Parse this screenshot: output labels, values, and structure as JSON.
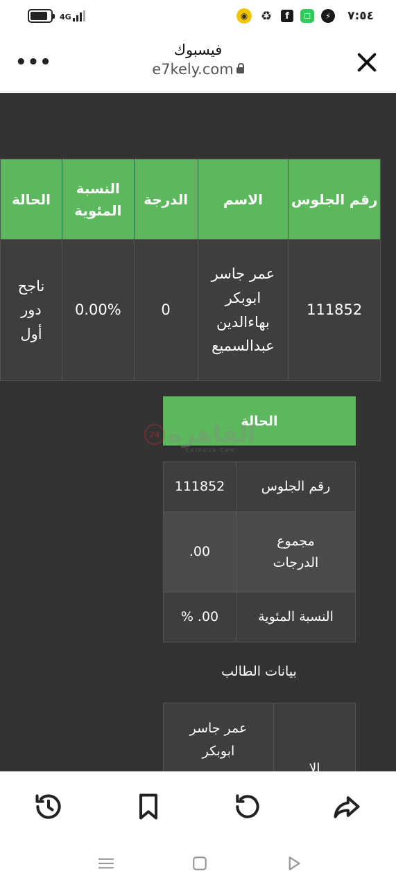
{
  "status_bar": {
    "time": "٧:٥٤",
    "network": "4G",
    "icons": [
      "battery-icon",
      "signal-icon",
      "notification-icon",
      "recycle-icon",
      "facebook-icon",
      "app-icon",
      "messenger-icon"
    ]
  },
  "browser": {
    "title": "فيسبوك",
    "url": "e7kely.com",
    "menu_label": "•••"
  },
  "main_table": {
    "headers": [
      "رقم الجلوس",
      "الاسم",
      "الدرجة",
      "النسبة المئوية",
      "الحالة"
    ],
    "row": {
      "seat_number": "111852",
      "name": "عمر جاسر ابوبكر بهاءالدين عبدالسميع",
      "score": "0",
      "percentage": "0.00%",
      "status": "ناجح دور أول"
    }
  },
  "status_header": "الحالة",
  "watermark": {
    "badge": "24",
    "text": "القاهرة",
    "sub": "CAIRO24.COM"
  },
  "details": {
    "seat_label": "رقم الجلوس",
    "seat_value": "111852",
    "total_label": "مجموع الدرجات",
    "total_value": "00.",
    "percent_label": "النسبة المئوية",
    "percent_value": "00. %"
  },
  "student_heading": "بيانات الطالب",
  "student_table": {
    "label_partial": "الا",
    "name_value": "عمر جاسر ابوبكر"
  },
  "colors": {
    "header_green": "#5cb85c",
    "page_dark": "#333333",
    "cell_dark": "#3e3e3e"
  }
}
